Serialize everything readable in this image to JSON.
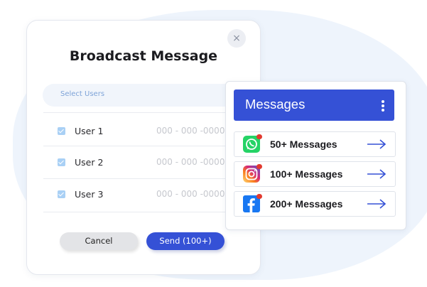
{
  "dialog": {
    "title": "Broadcast Message",
    "close_icon": "close-icon",
    "close_glyph": "×",
    "select_placeholder": "Select Users",
    "users": [
      {
        "name": "User 1",
        "phone": "000 - 000 -0000",
        "checked": true
      },
      {
        "name": "User 2",
        "phone": "000 - 000 -0000",
        "checked": true
      },
      {
        "name": "User 3",
        "phone": "000 - 000 -0000",
        "checked": true
      }
    ],
    "cancel_label": "Cancel",
    "send_label": "Send (100+)"
  },
  "messages": {
    "title": "Messages",
    "menu_icon": "more-vertical-icon",
    "items": [
      {
        "app_icon": "whatsapp-icon",
        "label": "50+ Messages"
      },
      {
        "app_icon": "instagram-icon",
        "label": "100+ Messages"
      },
      {
        "app_icon": "facebook-icon",
        "label": "200+ Messages"
      }
    ]
  },
  "colors": {
    "accent": "#3551d6",
    "background_blob": "#eef4fc",
    "checkbox": "#a9d0f5",
    "badge": "#e23a2f"
  }
}
